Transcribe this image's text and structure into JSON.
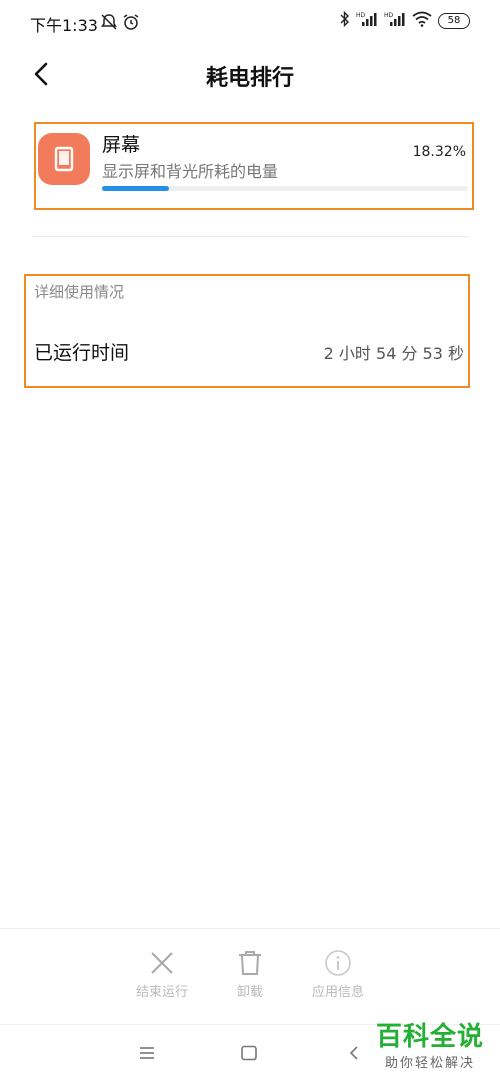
{
  "status_bar": {
    "time": "下午1:33",
    "battery": "58",
    "icons": [
      "do-not-disturb-icon",
      "alarm-icon",
      "bluetooth-icon",
      "hd-signal-icon",
      "hd-signal-icon",
      "wifi-icon",
      "battery-icon"
    ]
  },
  "header": {
    "title": "耗电排行",
    "back_icon": "back-chevron-icon"
  },
  "item": {
    "icon": "screen-icon",
    "icon_color": "#f27b5c",
    "title": "屏幕",
    "description": "显示屏和背光所耗的电量",
    "percent": "18.32%",
    "progress_fraction": 0.1832,
    "progress_color": "#2490e6"
  },
  "detail": {
    "header": "详细使用情况",
    "rows": [
      {
        "label": "已运行时间",
        "value": "2 小时 54 分 53 秒"
      }
    ]
  },
  "actions": [
    {
      "label": "结束运行",
      "icon": "close-icon"
    },
    {
      "label": "卸载",
      "icon": "trash-icon"
    },
    {
      "label": "应用信息",
      "icon": "info-icon"
    }
  ],
  "nav": {
    "icons": [
      "menu-icon",
      "home-icon",
      "back-icon"
    ]
  },
  "watermark": {
    "main": "百科全说",
    "sub": "助你轻松解决"
  },
  "colors": {
    "highlight_border": "#f08a22",
    "watermark_green": "#24b034"
  }
}
